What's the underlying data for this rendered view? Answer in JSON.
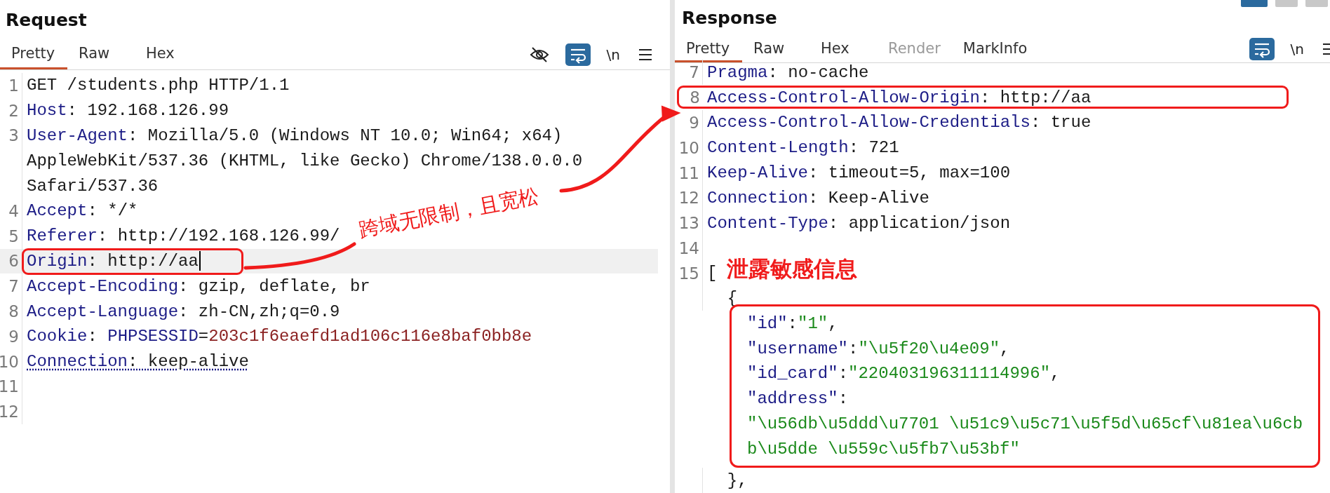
{
  "layout_buttons": [
    {
      "selected": true
    },
    {
      "selected": false
    },
    {
      "selected": false
    }
  ],
  "request": {
    "title": "Request",
    "tabs": [
      {
        "label": "Pretty",
        "selected": true,
        "disabled": false
      },
      {
        "label": "Raw",
        "selected": false,
        "disabled": false
      },
      {
        "label": "Hex",
        "selected": false,
        "disabled": false
      }
    ],
    "toolbar": [
      {
        "kind": "eye",
        "on": false
      },
      {
        "kind": "wrap",
        "on": true
      },
      {
        "kind": "text",
        "text": "\\n"
      },
      {
        "kind": "menu"
      }
    ],
    "lines": [
      {
        "kind": "row",
        "number": "1",
        "tokens": [
          {
            "kind": "plain",
            "text": "GET /students.php HTTP/1.1"
          }
        ]
      },
      {
        "kind": "row",
        "number": "2",
        "tokens": [
          {
            "kind": "key",
            "text": "Host"
          },
          {
            "kind": "plain",
            "text": ": 192.168.126.99"
          }
        ]
      },
      {
        "kind": "row",
        "number": "3",
        "tokens": [
          {
            "kind": "key",
            "text": "User-Agent"
          },
          {
            "kind": "plain",
            "text": ": Mozilla/5.0 (Windows NT 10.0; Win64; x64)"
          }
        ]
      },
      {
        "kind": "row",
        "tokens": [
          {
            "kind": "plain",
            "text": "AppleWebKit/537.36 (KHTML, like Gecko) Chrome/138.0.0.0"
          }
        ]
      },
      {
        "kind": "row",
        "tokens": [
          {
            "kind": "plain",
            "text": "Safari/537.36"
          }
        ]
      },
      {
        "kind": "row",
        "number": "4",
        "tokens": [
          {
            "kind": "key",
            "text": "Accept"
          },
          {
            "kind": "plain",
            "text": ": */*"
          }
        ]
      },
      {
        "kind": "row",
        "number": "5",
        "tokens": [
          {
            "kind": "key",
            "text": "Referer"
          },
          {
            "kind": "plain",
            "text": ": http://192.168.126.99/"
          }
        ]
      },
      {
        "kind": "row",
        "number": "6",
        "current": true,
        "boxed": true,
        "cursor": true,
        "tokens": [
          {
            "kind": "key",
            "text": "Origin"
          },
          {
            "kind": "plain",
            "text": ": http://aa"
          }
        ]
      },
      {
        "kind": "row",
        "number": "7",
        "tokens": [
          {
            "kind": "key",
            "text": "Accept-Encoding"
          },
          {
            "kind": "plain",
            "text": ": gzip, deflate, br"
          }
        ]
      },
      {
        "kind": "row",
        "number": "8",
        "tokens": [
          {
            "kind": "key",
            "text": "Accept-Language"
          },
          {
            "kind": "plain",
            "text": ": zh-CN,zh;q=0.9"
          }
        ]
      },
      {
        "kind": "row",
        "number": "9",
        "tokens": [
          {
            "kind": "key",
            "text": "Cookie"
          },
          {
            "kind": "plain",
            "text": ": "
          },
          {
            "kind": "key",
            "text": "PHPSESSID"
          },
          {
            "kind": "plain",
            "text": "="
          },
          {
            "kind": "cookie",
            "text": "203c1f6eaefd1ad106c116e8baf0bb8e"
          }
        ]
      },
      {
        "kind": "row",
        "number": "10",
        "underlined": true,
        "tokens": [
          {
            "kind": "key",
            "text": "Connection"
          },
          {
            "kind": "plain",
            "text": ": keep-alive"
          }
        ]
      },
      {
        "kind": "row",
        "number": "11"
      },
      {
        "kind": "row",
        "number": "12"
      }
    ]
  },
  "response": {
    "title": "Response",
    "tabs": [
      {
        "label": "Pretty",
        "selected": true,
        "disabled": false
      },
      {
        "label": "Raw",
        "selected": false,
        "disabled": false
      },
      {
        "label": "Hex",
        "selected": false,
        "disabled": false
      },
      {
        "label": "Render",
        "selected": false,
        "disabled": true
      },
      {
        "label": "MarkInfo",
        "selected": false,
        "disabled": false
      }
    ],
    "toolbar": [
      {
        "kind": "wrap",
        "on": true
      },
      {
        "kind": "text",
        "text": "\\n"
      },
      {
        "kind": "menu"
      }
    ],
    "lines": [
      {
        "kind": "row",
        "number": "7",
        "tokens": [
          {
            "kind": "key",
            "text": "Pragma"
          },
          {
            "kind": "plain",
            "text": ": no-cache"
          }
        ]
      },
      {
        "kind": "row",
        "number": "8",
        "boxed": true,
        "tokens": [
          {
            "kind": "key",
            "text": "Access-Control-Allow-Origin"
          },
          {
            "kind": "plain",
            "text": ": http://aa"
          }
        ]
      },
      {
        "kind": "row",
        "number": "9",
        "tokens": [
          {
            "kind": "key",
            "text": "Access-Control-Allow-Credentials"
          },
          {
            "kind": "plain",
            "text": ": true"
          }
        ]
      },
      {
        "kind": "row",
        "number": "10",
        "tokens": [
          {
            "kind": "key",
            "text": "Content-Length"
          },
          {
            "kind": "plain",
            "text": ": 721"
          }
        ]
      },
      {
        "kind": "row",
        "number": "11",
        "tokens": [
          {
            "kind": "key",
            "text": "Keep-Alive"
          },
          {
            "kind": "plain",
            "text": ": timeout=5, max=100"
          }
        ]
      },
      {
        "kind": "row",
        "number": "12",
        "tokens": [
          {
            "kind": "key",
            "text": "Connection"
          },
          {
            "kind": "plain",
            "text": ": Keep-Alive"
          }
        ]
      },
      {
        "kind": "row",
        "number": "13",
        "tokens": [
          {
            "kind": "key",
            "text": "Content-Type"
          },
          {
            "kind": "plain",
            "text": ": application/json"
          }
        ]
      },
      {
        "kind": "row",
        "number": "14"
      },
      {
        "kind": "row",
        "number": "15",
        "tokens": [
          {
            "kind": "plain",
            "text": "["
          }
        ]
      },
      {
        "kind": "row",
        "tokens": [
          {
            "kind": "plain",
            "text": "  {"
          }
        ]
      },
      {
        "kind": "box",
        "rows": [
          {
            "tokens": [
              {
                "kind": "key",
                "text": "\"id\""
              },
              {
                "kind": "plain",
                "text": ":"
              },
              {
                "kind": "string",
                "text": "\"1\""
              },
              {
                "kind": "plain",
                "text": ","
              }
            ]
          },
          {
            "tokens": [
              {
                "kind": "key",
                "text": "\"username\""
              },
              {
                "kind": "plain",
                "text": ":"
              },
              {
                "kind": "string",
                "text": "\"\\u5f20\\u4e09\""
              },
              {
                "kind": "plain",
                "text": ","
              }
            ]
          },
          {
            "tokens": [
              {
                "kind": "key",
                "text": "\"id_card\""
              },
              {
                "kind": "plain",
                "text": ":"
              },
              {
                "kind": "string",
                "text": "\"220403196311114996\""
              },
              {
                "kind": "plain",
                "text": ","
              }
            ]
          },
          {
            "tokens": [
              {
                "kind": "key",
                "text": "\"address\""
              },
              {
                "kind": "plain",
                "text": ":"
              }
            ]
          },
          {
            "tokens": [
              {
                "kind": "string",
                "text": "\"\\u56db\\u5ddd\\u7701 \\u51c9\\u5c71\\u5f5d\\u65cf\\u81ea\\u6cb"
              }
            ]
          },
          {
            "tokens": [
              {
                "kind": "string",
                "text": "b\\u5dde \\u559c\\u5fb7\\u53bf\""
              }
            ]
          }
        ]
      },
      {
        "kind": "row",
        "tokens": [
          {
            "kind": "plain",
            "text": "  },"
          }
        ]
      }
    ]
  },
  "annotations": [
    {
      "kind": "callout",
      "text": "跨域无限制，且宽松"
    },
    {
      "kind": "label",
      "text": "泄露敏感信息"
    }
  ]
}
